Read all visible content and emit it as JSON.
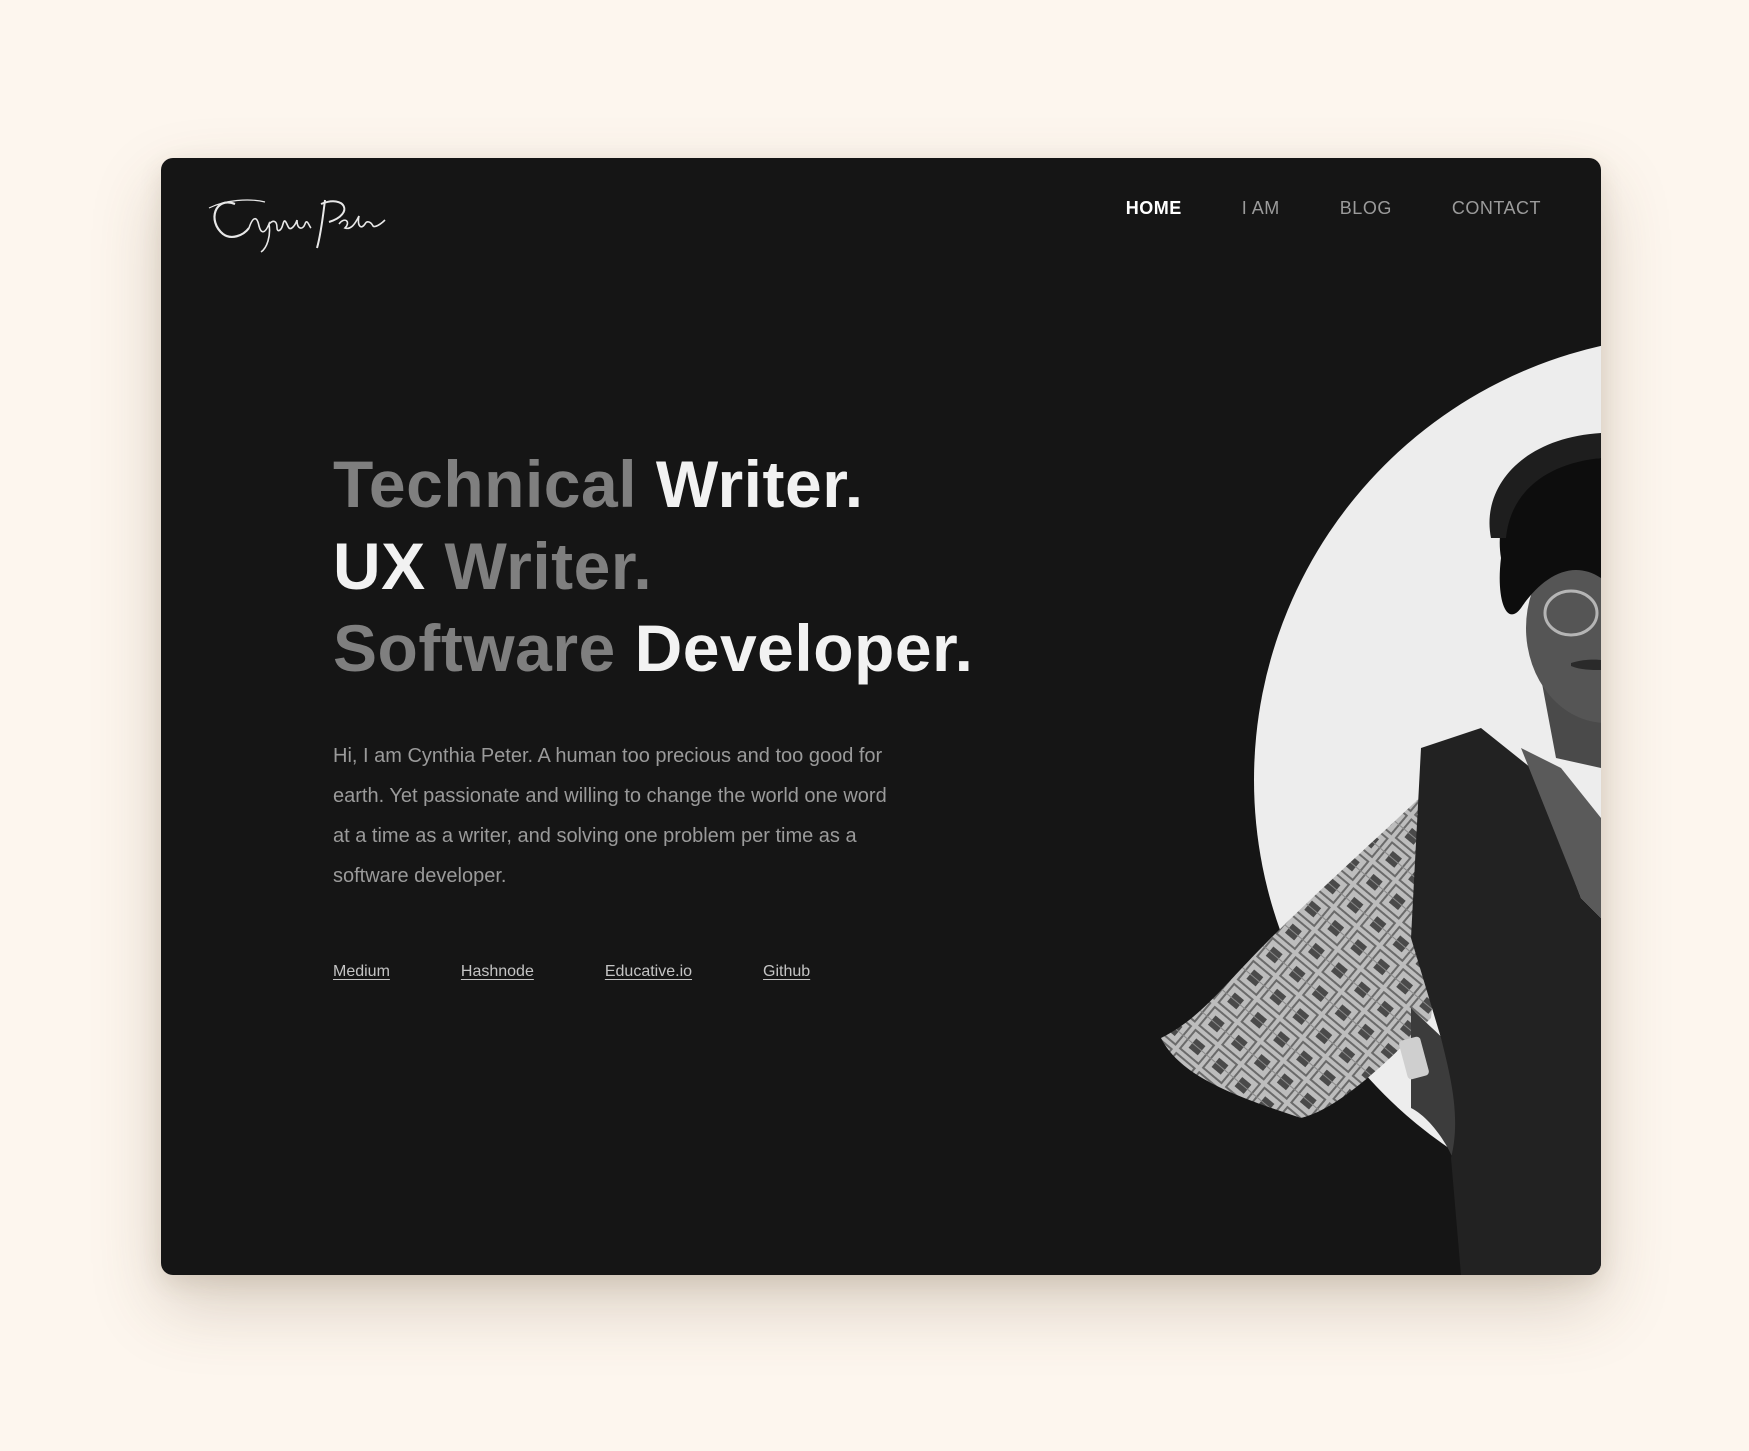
{
  "brand": {
    "logo_text": "Cynthia Peter"
  },
  "nav": {
    "items": [
      {
        "label": "HOME",
        "active": true
      },
      {
        "label": "I AM",
        "active": false
      },
      {
        "label": "BLOG",
        "active": false
      },
      {
        "label": "CONTACT",
        "active": false
      }
    ]
  },
  "hero": {
    "lines": [
      {
        "dim": "Technical",
        "bright": "Writer."
      },
      {
        "bright": "UX",
        "dim": "Writer."
      },
      {
        "dim": "Software",
        "bright": "Developer."
      }
    ],
    "intro": "Hi, I am Cynthia Peter. A human too precious and too good for earth. Yet passionate and willing to change the world one word at a time as a writer, and solving one problem per time as a software developer."
  },
  "links": [
    {
      "label": "Medium"
    },
    {
      "label": "Hashnode"
    },
    {
      "label": "Educative.io"
    },
    {
      "label": "Github"
    }
  ],
  "colors": {
    "page_background": "#fdf6ee",
    "window_background": "#151515",
    "dim_text": "#7f7f7f",
    "bright_text": "#f2f2f2",
    "photo_circle": "#ededed"
  }
}
